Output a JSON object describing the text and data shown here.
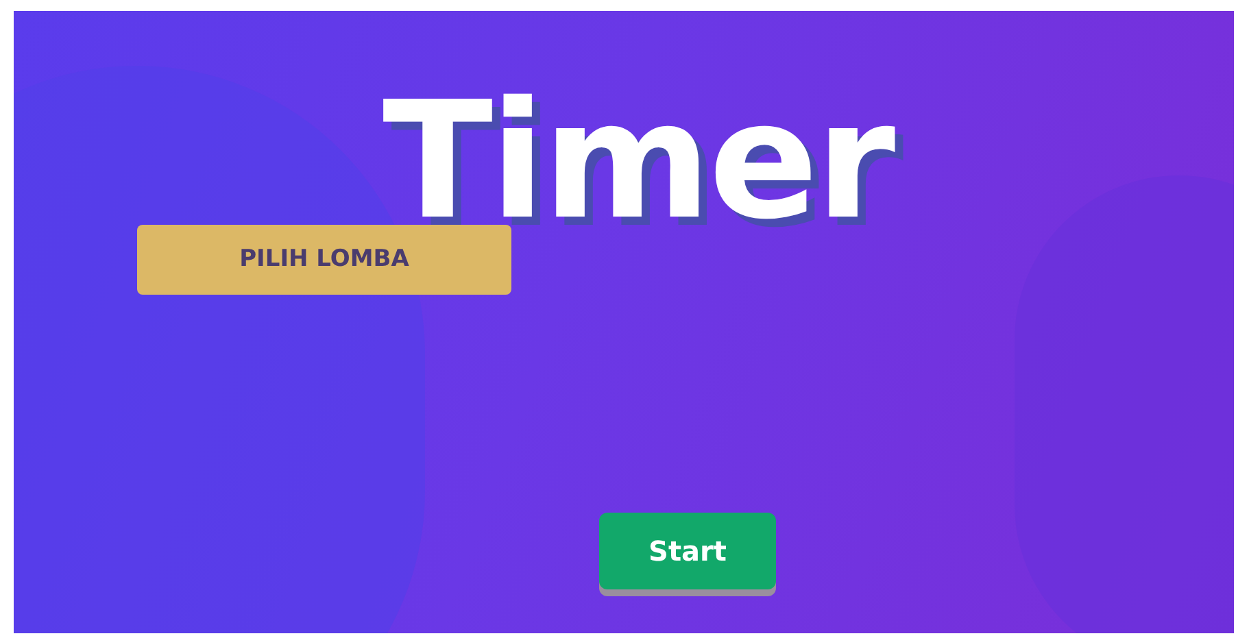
{
  "title": "Timer",
  "select_button": {
    "label": "PILIH LOMBA"
  },
  "start_button": {
    "label": "Start"
  }
}
